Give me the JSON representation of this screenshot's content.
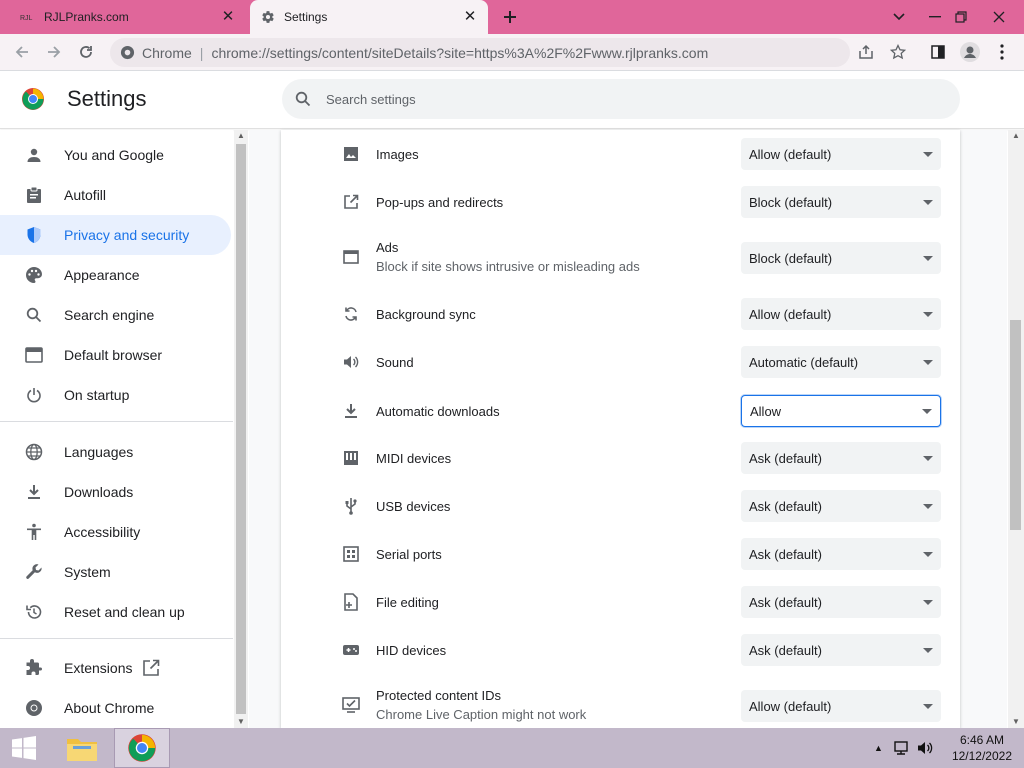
{
  "browser": {
    "tabs": [
      {
        "title": "RJLPranks.com",
        "favicon": "rjl-favicon",
        "active": false
      },
      {
        "title": "Settings",
        "favicon": "gear-icon",
        "active": true
      }
    ],
    "new_tab_icon": "plus-icon",
    "omnibox": {
      "site_label": "Chrome",
      "separator": "|",
      "url": "chrome://settings/content/siteDetails?site=https%3A%2F%2Fwww.rjlpranks.com"
    }
  },
  "settings": {
    "title": "Settings",
    "search_placeholder": "Search settings"
  },
  "sidebar": {
    "items": [
      {
        "label": "You and Google",
        "icon": "person-icon"
      },
      {
        "label": "Autofill",
        "icon": "clipboard-icon"
      },
      {
        "label": "Privacy and security",
        "icon": "shield-icon",
        "active": true
      },
      {
        "label": "Appearance",
        "icon": "palette-icon"
      },
      {
        "label": "Search engine",
        "icon": "search-icon"
      },
      {
        "label": "Default browser",
        "icon": "browser-icon"
      },
      {
        "label": "On startup",
        "icon": "power-icon"
      },
      {
        "label": "Languages",
        "icon": "globe-icon"
      },
      {
        "label": "Downloads",
        "icon": "download-icon"
      },
      {
        "label": "Accessibility",
        "icon": "accessibility-icon"
      },
      {
        "label": "System",
        "icon": "wrench-icon"
      },
      {
        "label": "Reset and clean up",
        "icon": "reset-icon"
      },
      {
        "label": "Extensions",
        "icon": "puzzle-icon"
      },
      {
        "label": "About Chrome",
        "icon": "chrome-icon"
      }
    ]
  },
  "permissions": [
    {
      "label": "Images",
      "sub": "",
      "value": "Allow (default)",
      "icon": "image-icon"
    },
    {
      "label": "Pop-ups and redirects",
      "sub": "",
      "value": "Block (default)",
      "icon": "open-external-icon"
    },
    {
      "label": "Ads",
      "sub": "Block if site shows intrusive or misleading ads",
      "value": "Block (default)",
      "icon": "ads-window-icon"
    },
    {
      "label": "Background sync",
      "sub": "",
      "value": "Allow (default)",
      "icon": "sync-icon"
    },
    {
      "label": "Sound",
      "sub": "",
      "value": "Automatic (default)",
      "icon": "speaker-icon"
    },
    {
      "label": "Automatic downloads",
      "sub": "",
      "value": "Allow",
      "icon": "download-icon",
      "focused": true
    },
    {
      "label": "MIDI devices",
      "sub": "",
      "value": "Ask (default)",
      "icon": "piano-icon"
    },
    {
      "label": "USB devices",
      "sub": "",
      "value": "Ask (default)",
      "icon": "usb-icon"
    },
    {
      "label": "Serial ports",
      "sub": "",
      "value": "Ask (default)",
      "icon": "serial-port-icon"
    },
    {
      "label": "File editing",
      "sub": "",
      "value": "Ask (default)",
      "icon": "file-edit-icon"
    },
    {
      "label": "HID devices",
      "sub": "",
      "value": "Ask (default)",
      "icon": "gamepad-icon"
    },
    {
      "label": "Protected content IDs",
      "sub": "Chrome Live Caption might not work",
      "value": "Allow (default)",
      "icon": "protected-content-icon"
    }
  ],
  "taskbar": {
    "time": "6:46 AM",
    "date": "12/12/2022"
  },
  "colors": {
    "titlebar": "#e0669a",
    "accent": "#1a73e8",
    "active_nav_bg": "#e8f0fe"
  }
}
